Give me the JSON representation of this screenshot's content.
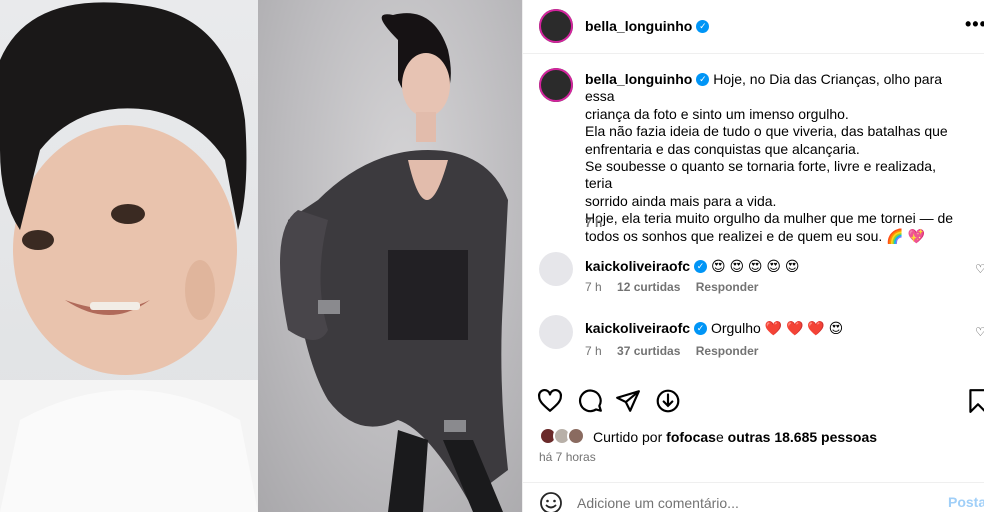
{
  "post": {
    "author": "bella_longuinho",
    "verified_icon": "verified-badge-icon",
    "more_label": "•••",
    "caption": {
      "username": "bella_longuinho",
      "lines": [
        "Hoje, no Dia das Crianças, olho para essa",
        "criança da foto e sinto um imenso orgulho.",
        "Ela não fazia ideia de tudo o que viveria, das batalhas que",
        "enfrentaria e das conquistas que alcançaria.",
        "Se soubesse o quanto se tornaria forte, livre e realizada, teria",
        "sorrido ainda mais para a vida.",
        "Hoje, ela teria muito orgulho da mulher que me tornei — de",
        "todos os sonhos que realizei e de quem eu sou. 🌈 💖"
      ],
      "time": "7 h"
    }
  },
  "comments": [
    {
      "username": "kaickoliveiraofc",
      "text": "😍 😍 😍 😍 😍",
      "time": "7 h",
      "likes": "12 curtidas",
      "reply": "Responder"
    },
    {
      "username": "kaickoliveiraofc",
      "text": "Orgulho ❤️ ❤️ ❤️ 😍",
      "time": "7 h",
      "likes": "37 curtidas",
      "reply": "Responder"
    }
  ],
  "likes": {
    "prefix": "Curtido por ",
    "first_user": "fofocas",
    "middle": " e ",
    "others": "outras 18.685 pessoas"
  },
  "posted_ago": "há 7 horas",
  "add_comment": {
    "placeholder": "Adicione um comentário...",
    "post_label": "Postar"
  },
  "colors": {
    "verified": "#0095f6",
    "secondary_text": "#737373",
    "post_button": "#a0cff8",
    "story_ring": "#d6249f"
  }
}
